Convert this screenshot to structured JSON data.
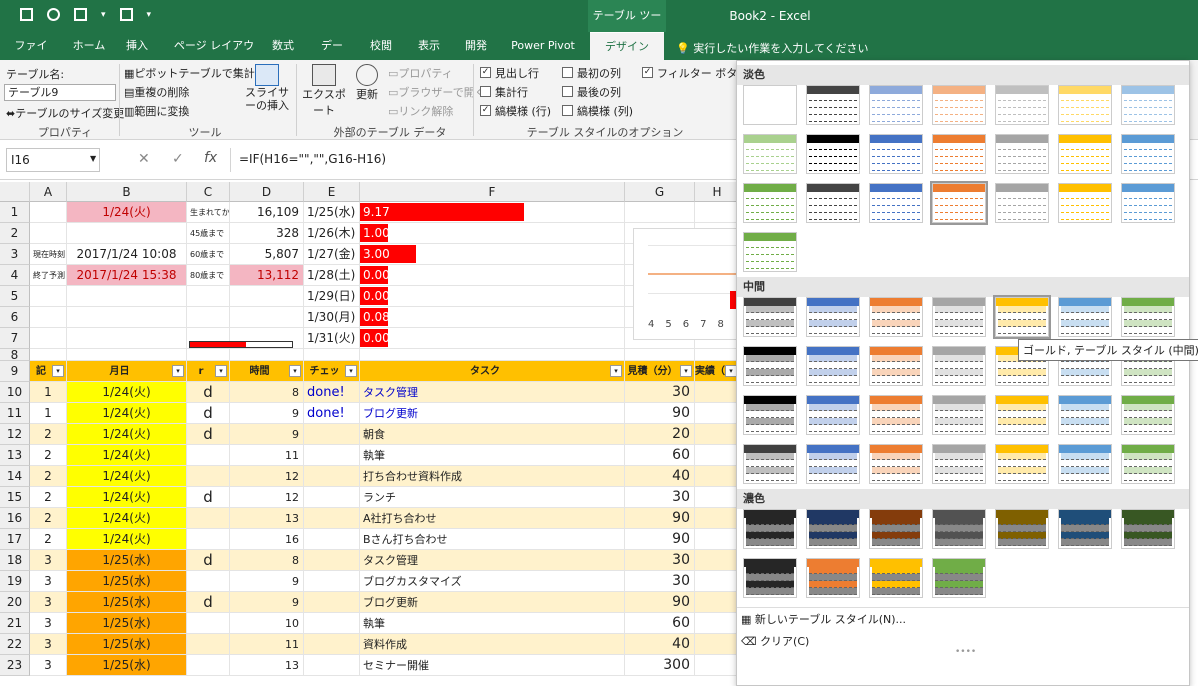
{
  "title_bar": {
    "context": "テーブル ツール",
    "doc_title": "Book2 - Excel",
    "qat": [
      "save-icon",
      "undo-icon",
      "form-icon",
      "dropdown-icon",
      "custom-icon",
      "more-icon"
    ]
  },
  "tabs": [
    "ファイル",
    "ホーム",
    "挿入",
    "ページ レイアウト",
    "数式",
    "データ",
    "校閲",
    "表示",
    "開発",
    "Power Pivot",
    "デザイン"
  ],
  "active_tab": "デザイン",
  "tellme": "実行したい作業を入力してください",
  "ribbon": {
    "props": {
      "name_label": "テーブル名:",
      "name_value": "テーブル9",
      "resize": "テーブルのサイズ変更",
      "group": "プロパティ"
    },
    "tools": {
      "pivot": "ピボットテーブルで集計",
      "dedupe": "重複の削除",
      "convert": "範囲に変換",
      "slicer": "スライサーの挿入",
      "group": "ツール"
    },
    "external": {
      "export": "エクスポート",
      "refresh": "更新",
      "property": "プロパティ",
      "browser": "ブラウザーで開く",
      "unlink": "リンク解除",
      "group": "外部のテーブル データ"
    },
    "options": {
      "items": [
        {
          "label": "見出し行",
          "checked": true
        },
        {
          "label": "集計行",
          "checked": false
        },
        {
          "label": "縞模様 (行)",
          "checked": true
        },
        {
          "label": "最初の列",
          "checked": false
        },
        {
          "label": "最後の列",
          "checked": false
        },
        {
          "label": "縞模様 (列)",
          "checked": false
        },
        {
          "label": "フィルター ボタン",
          "checked": true
        }
      ],
      "group": "テーブル スタイルのオプション"
    }
  },
  "formula_bar": {
    "cell_ref": "I16",
    "formula": "=IF(H16=\"\",\"\",G16-H16)",
    "fx": "fx"
  },
  "columns": [
    "A",
    "B",
    "C",
    "D",
    "E",
    "F",
    "G",
    "H"
  ],
  "top_rows": [
    {
      "n": "1",
      "a": "",
      "b": "1/24(火)",
      "c": "生まれてから",
      "d": "16,109",
      "e": "1/25(水)",
      "f": "9.17",
      "bar": 0.62
    },
    {
      "n": "2",
      "a": "",
      "b": "",
      "c": "45歳まで",
      "d": "328",
      "e": "1/26(木)",
      "f": "1.00",
      "bar": 0.07
    },
    {
      "n": "3",
      "a": "現在時刻",
      "b": "2017/1/24 10:08",
      "c": "60歳まで",
      "d": "5,807",
      "e": "1/27(金)",
      "f": "3.00",
      "bar": 0.21
    },
    {
      "n": "4",
      "a": "終了予測",
      "b": "2017/1/24 15:38",
      "c": "80歳まで",
      "d": "13,112",
      "e": "1/28(土)",
      "f": "0.00",
      "bar": 0.0
    },
    {
      "n": "5",
      "a": "",
      "b": "",
      "c": "",
      "d": "",
      "e": "1/29(日)",
      "f": "0.00",
      "bar": 0.0
    },
    {
      "n": "6",
      "a": "",
      "b": "",
      "c": "",
      "d": "",
      "e": "1/30(月)",
      "f": "0.08",
      "bar": 0.0
    },
    {
      "n": "7",
      "a": "",
      "b": "",
      "c": "",
      "d": "",
      "e": "1/31(火)",
      "f": "0.00",
      "bar": 0.0
    },
    {
      "n": "8",
      "a": "",
      "b": "",
      "c": "",
      "d": "",
      "e": "",
      "f": "",
      "bar": 0.0
    }
  ],
  "progress_c7": 0.55,
  "chart_axis": [
    "4",
    "5",
    "6",
    "7",
    "8"
  ],
  "table_header": {
    "n": "9",
    "a": "記",
    "b": "月日",
    "c": "r",
    "d": "時間",
    "e": "チェッ",
    "f": "タスク",
    "g": "見積（分）",
    "h": "実績（分"
  },
  "table_rows": [
    {
      "n": "10",
      "a": "1",
      "b": "1/24(火)",
      "c": "d",
      "d": "8",
      "e": "done!",
      "f": "タスク管理",
      "g": "30",
      "day": 1
    },
    {
      "n": "11",
      "a": "1",
      "b": "1/24(火)",
      "c": "d",
      "d": "9",
      "e": "done!",
      "f": "ブログ更新",
      "g": "90",
      "day": 1
    },
    {
      "n": "12",
      "a": "2",
      "b": "1/24(火)",
      "c": "d",
      "d": "9",
      "e": "",
      "f": "朝食",
      "g": "20",
      "day": 1
    },
    {
      "n": "13",
      "a": "2",
      "b": "1/24(火)",
      "c": "",
      "d": "11",
      "e": "",
      "f": "執筆",
      "g": "60",
      "day": 1
    },
    {
      "n": "14",
      "a": "2",
      "b": "1/24(火)",
      "c": "",
      "d": "12",
      "e": "",
      "f": "打ち合わせ資料作成",
      "g": "40",
      "day": 1
    },
    {
      "n": "15",
      "a": "2",
      "b": "1/24(火)",
      "c": "d",
      "d": "12",
      "e": "",
      "f": "ランチ",
      "g": "30",
      "day": 1
    },
    {
      "n": "16",
      "a": "2",
      "b": "1/24(火)",
      "c": "",
      "d": "13",
      "e": "",
      "f": "A社打ち合わせ",
      "g": "90",
      "day": 1
    },
    {
      "n": "17",
      "a": "2",
      "b": "1/24(火)",
      "c": "",
      "d": "16",
      "e": "",
      "f": "Bさん打ち合わせ",
      "g": "90",
      "day": 1
    },
    {
      "n": "18",
      "a": "3",
      "b": "1/25(水)",
      "c": "d",
      "d": "8",
      "e": "",
      "f": "タスク管理",
      "g": "30",
      "day": 2
    },
    {
      "n": "19",
      "a": "3",
      "b": "1/25(水)",
      "c": "",
      "d": "9",
      "e": "",
      "f": "ブログカスタマイズ",
      "g": "30",
      "day": 2
    },
    {
      "n": "20",
      "a": "3",
      "b": "1/25(水)",
      "c": "d",
      "d": "9",
      "e": "",
      "f": "ブログ更新",
      "g": "90",
      "day": 2
    },
    {
      "n": "21",
      "a": "3",
      "b": "1/25(水)",
      "c": "",
      "d": "10",
      "e": "",
      "f": "執筆",
      "g": "60",
      "day": 2
    },
    {
      "n": "22",
      "a": "3",
      "b": "1/25(水)",
      "c": "",
      "d": "11",
      "e": "",
      "f": "資料作成",
      "g": "40",
      "day": 2
    },
    {
      "n": "23",
      "a": "3",
      "b": "1/25(水)",
      "c": "",
      "d": "13",
      "e": "",
      "f": "セミナー開催",
      "g": "300",
      "day": 2
    }
  ],
  "gallery": {
    "sections": [
      "淡色",
      "中間",
      "濃色"
    ],
    "light": [
      "#ffffff",
      "#444444",
      "#8eaadb",
      "#f4b183",
      "#bfbfbf",
      "#ffd966",
      "#9dc3e6",
      "#a9d18e",
      "#000000",
      "#4472c4",
      "#ed7d31",
      "#a5a5a5",
      "#ffc000",
      "#5b9bd5",
      "#70ad47",
      "#444444",
      "#4472c4",
      "#ed7d31",
      "#a5a5a5",
      "#ffc000",
      "#5b9bd5",
      "#70ad47"
    ],
    "medium": [
      "#404040",
      "#4472c4",
      "#ed7d31",
      "#a5a5a5",
      "#ffc000",
      "#5b9bd5",
      "#70ad47",
      "#000000",
      "#4472c4",
      "#ed7d31",
      "#a5a5a5",
      "#ffc000",
      "#5b9bd5",
      "#70ad47",
      "#000000",
      "#4472c4",
      "#ed7d31",
      "#a5a5a5",
      "#ffc000",
      "#5b9bd5",
      "#70ad47",
      "#404040",
      "#4472c4",
      "#ed7d31",
      "#a5a5a5",
      "#ffc000",
      "#5b9bd5",
      "#70ad47"
    ],
    "dark": [
      "#262626",
      "#203864",
      "#843c0c",
      "#525252",
      "#7f6000",
      "#1f4e79",
      "#385723",
      "#262626",
      "#ed7d31",
      "#ffc000",
      "#70ad47"
    ],
    "tooltip": "ゴールド, テーブル スタイル (中間) 5",
    "new_style": "新しいテーブル スタイル(N)...",
    "clear": "クリア(C)"
  }
}
